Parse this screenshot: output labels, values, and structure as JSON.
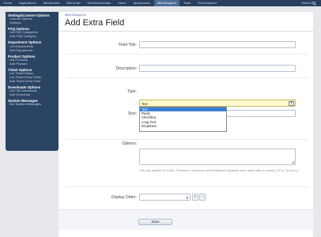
{
  "nav": {
    "tabs": [
      "Home",
      "Applications",
      "Microkudos",
      "MicroCart",
      "MicroDownloads",
      "Users",
      "Appearance",
      "MicroSupport",
      "Tools",
      "Development"
    ],
    "active_tab": "MicroSupport",
    "search_label": "Search"
  },
  "sidebar": {
    "groups": [
      {
        "title": "Settings/License Options",
        "links": [
          "License Options",
          "Settings"
        ]
      },
      {
        "title": "FAQ Options",
        "links": [
          "List FAQ Categories",
          "Add FAQ Category"
        ]
      },
      {
        "title": "Department Options",
        "links": [
          "List Departments",
          "Add Department"
        ]
      },
      {
        "title": "Product Options",
        "links": [
          "List Products",
          "Add Product"
        ]
      },
      {
        "title": "Ticket Options",
        "links": [
          "List Ticket Status",
          "List Ticket Extra Fields",
          "Add Ticket Extra Field"
        ]
      },
      {
        "title": "Downloads Options",
        "links": [
          "List File Downloads",
          "Add Download"
        ]
      },
      {
        "title": "System Messages",
        "links": [
          "List System Messages"
        ]
      }
    ]
  },
  "page": {
    "breadcrumb": "MicroSupport ▸",
    "title": "Add Extra Field"
  },
  "form": {
    "field_title_label": "Field Title:",
    "description_label": "Description:",
    "type_label": "Type:",
    "type_value": "Text",
    "type_options": [
      "Text",
      "Radio",
      "Checkbox",
      "Long Text",
      "Dropdown"
    ],
    "size_label": "Size:",
    "size_hint": "This only applies for Text fields.",
    "options_label": "Options:",
    "options_hint": "This only applies for Radio, Checkbox, Dropdown and Multiselect Separate each option with a comma (,) E.g. Yes,No (,)",
    "display_order_label": "Display Order:",
    "display_order_value": "0",
    "save_label": "Save"
  }
}
